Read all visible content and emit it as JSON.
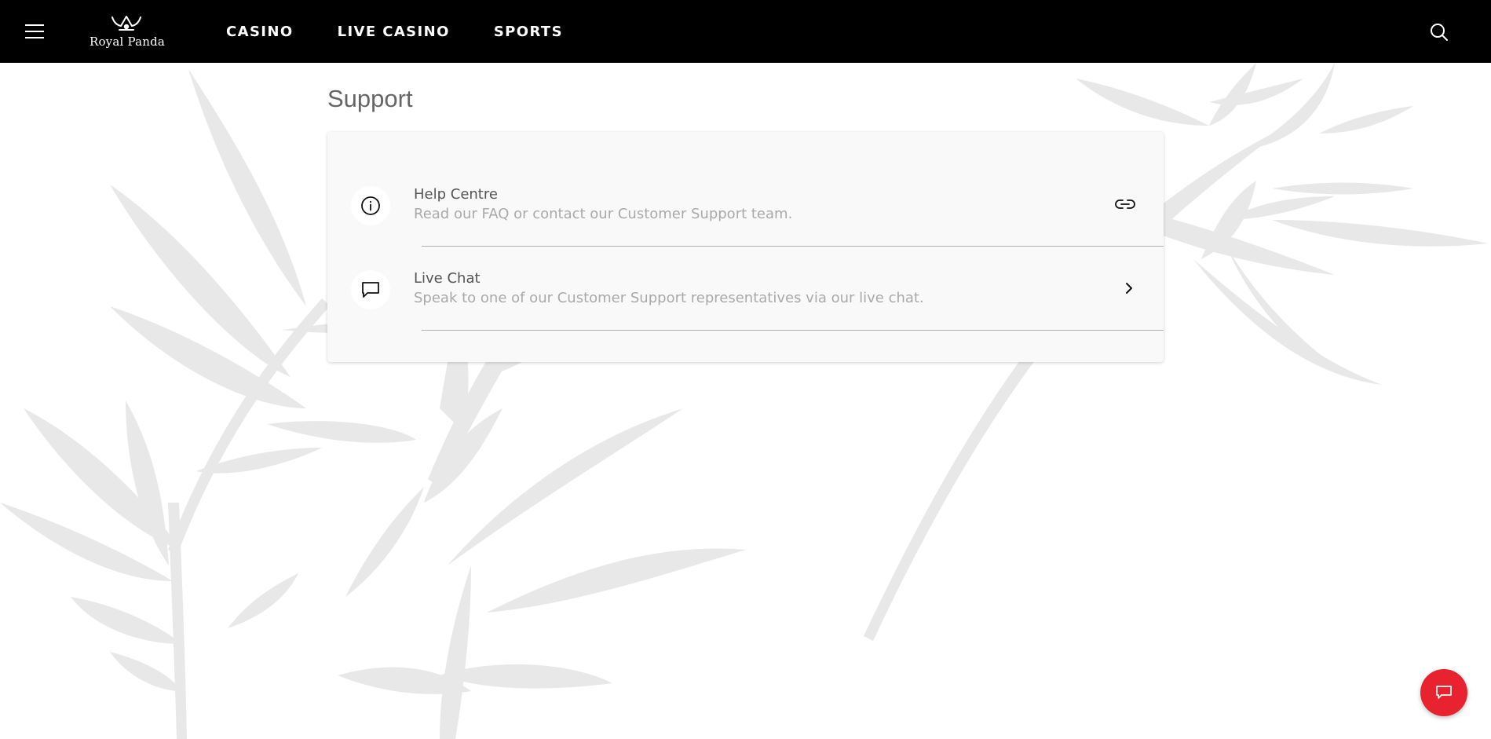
{
  "brand": {
    "name": "Royal Panda",
    "logo_text": "Royal Panda"
  },
  "nav": {
    "menu_icon": "hamburger-menu-icon",
    "items": [
      {
        "label": "CASINO"
      },
      {
        "label": "LIVE CASINO"
      },
      {
        "label": "SPORTS"
      }
    ],
    "search_icon": "search-icon"
  },
  "page": {
    "title": "Support"
  },
  "support_options": [
    {
      "title": "Help Centre",
      "description": "Read our FAQ or contact our Customer Support team.",
      "icon": "info-icon",
      "action_icon": "link-icon"
    },
    {
      "title": "Live Chat",
      "description": "Speak to one of our Customer Support representatives via our live chat.",
      "icon": "chat-bubble-icon",
      "action_icon": "chevron-right-icon"
    }
  ],
  "chat_fab": {
    "icon": "chat-bubble-icon"
  },
  "colors": {
    "header_bg": "#000000",
    "accent": "#e8232f",
    "card_bg": "#f9f9f9",
    "title_text": "#666666",
    "muted_text": "#a9a9a9",
    "background_art": "#e6e6e6"
  }
}
